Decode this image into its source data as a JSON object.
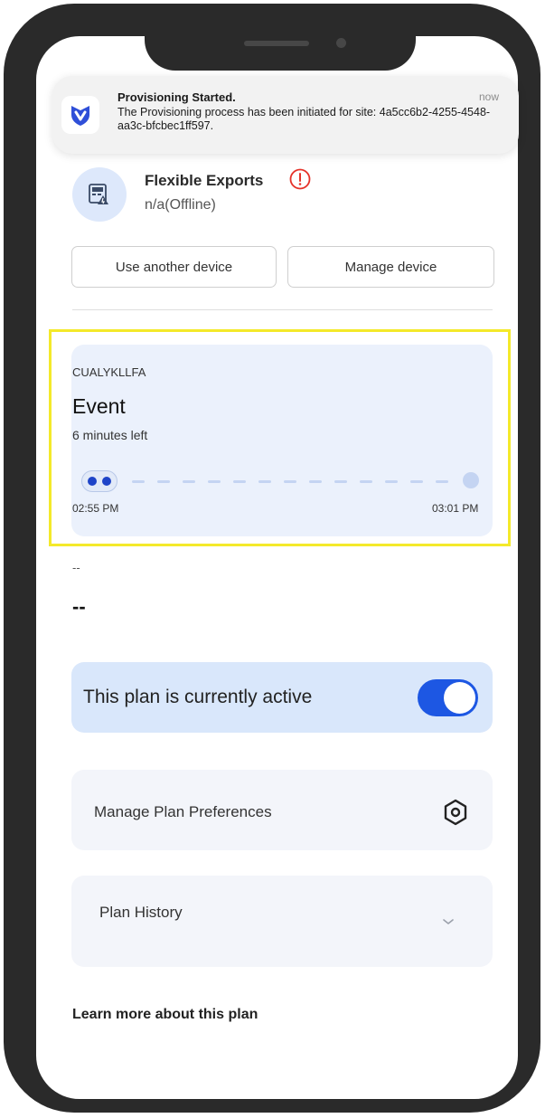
{
  "notification": {
    "app_icon": "app-logo-icon",
    "title": "Provisioning Started.",
    "time": "now",
    "body": "The Provisioning process has been initiated for site: 4a5cc6b2-4255-4548-aa3c-bfcbec1ff597."
  },
  "device": {
    "icon": "device-meter-icon",
    "name": "Flexible Exports",
    "alert_icon": "alert-circle-icon",
    "status": "n/a(Offline)"
  },
  "actions": {
    "use_another": "Use another device",
    "manage": "Manage device"
  },
  "event": {
    "code": "CUALYKLLFA",
    "title": "Event",
    "remaining": "6 minutes left",
    "start_time": "02:55 PM",
    "end_time": "03:01 PM",
    "progress": 0.1
  },
  "plan": {
    "subtitle": "--",
    "value": "--",
    "active_label": "This plan is currently active",
    "active": true,
    "preferences_label": "Manage Plan Preferences",
    "history_label": "Plan History",
    "learn_more": "Learn more about this plan"
  },
  "colors": {
    "accent": "#1d57e3",
    "highlight": "#f4e92a",
    "card": "#ebf1fc",
    "alert": "#e5332a"
  }
}
